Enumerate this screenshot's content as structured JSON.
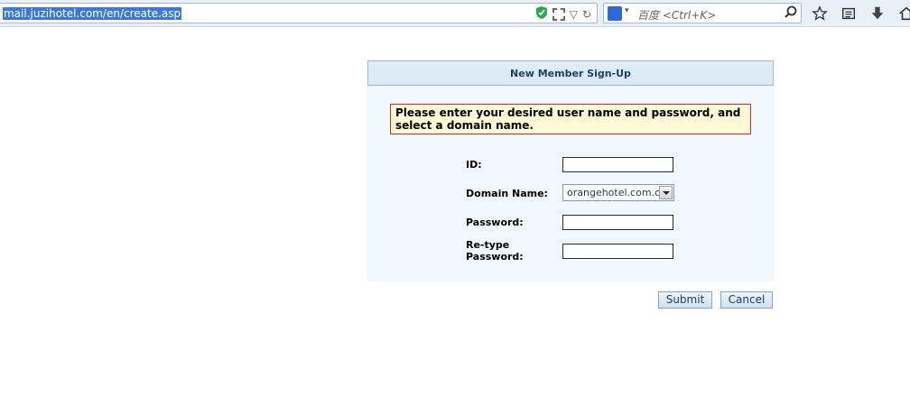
{
  "browser": {
    "url": "mail.juzihotel.com/en/create.asp",
    "search_placeholder": "百度 <Ctrl+K>"
  },
  "form": {
    "title": "New Member Sign-Up",
    "notice": "Please enter your desired user name and password, and select a domain name.",
    "fields": {
      "id_label": "ID:",
      "domain_label": "Domain Name:",
      "domain_value": "orangehotel.com.cn",
      "password_label": "Password:",
      "retype_label_line1": "Re-type",
      "retype_label_line2": "Password:"
    },
    "buttons": {
      "submit": "Submit",
      "cancel": "Cancel"
    }
  },
  "colors": {
    "header_bg": "#d8e8f5",
    "panel_bg": "#f1f8fd",
    "notice_bg": "#fff9d6",
    "notice_border": "#d12a2a",
    "title_text": "#1c3f6e"
  }
}
